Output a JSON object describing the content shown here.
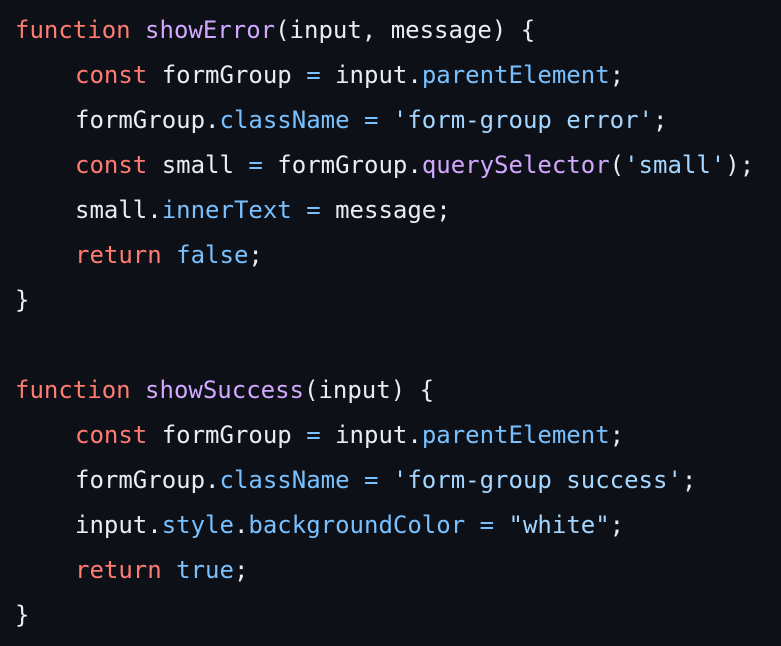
{
  "colors": {
    "background": "#0d1117",
    "text": "#e6edf3",
    "keyword": "#ff7b72",
    "function_name": "#d2a8ff",
    "property": "#79c0ff",
    "string": "#a5d6ff"
  },
  "code": {
    "lines": [
      {
        "indent": 0,
        "tokens": [
          {
            "text": "function",
            "type": "kw"
          },
          {
            "text": " ",
            "type": "plain"
          },
          {
            "text": "showError",
            "type": "fn"
          },
          {
            "text": "(input, message) {",
            "type": "plain"
          }
        ]
      },
      {
        "indent": 1,
        "tokens": [
          {
            "text": "const",
            "type": "kw"
          },
          {
            "text": " formGroup ",
            "type": "plain"
          },
          {
            "text": "=",
            "type": "prop"
          },
          {
            "text": " input.",
            "type": "plain"
          },
          {
            "text": "parentElement",
            "type": "prop"
          },
          {
            "text": ";",
            "type": "plain"
          }
        ]
      },
      {
        "indent": 1,
        "tokens": [
          {
            "text": "formGroup.",
            "type": "plain"
          },
          {
            "text": "className",
            "type": "prop"
          },
          {
            "text": " ",
            "type": "plain"
          },
          {
            "text": "=",
            "type": "prop"
          },
          {
            "text": " ",
            "type": "plain"
          },
          {
            "text": "'form-group error'",
            "type": "str"
          },
          {
            "text": ";",
            "type": "plain"
          }
        ]
      },
      {
        "indent": 1,
        "tokens": [
          {
            "text": "const",
            "type": "kw"
          },
          {
            "text": " small ",
            "type": "plain"
          },
          {
            "text": "=",
            "type": "prop"
          },
          {
            "text": " formGroup.",
            "type": "plain"
          },
          {
            "text": "querySelector",
            "type": "fn"
          },
          {
            "text": "(",
            "type": "plain"
          },
          {
            "text": "'small'",
            "type": "str"
          },
          {
            "text": ");",
            "type": "plain"
          }
        ]
      },
      {
        "indent": 1,
        "tokens": [
          {
            "text": "small.",
            "type": "plain"
          },
          {
            "text": "innerText",
            "type": "prop"
          },
          {
            "text": " ",
            "type": "plain"
          },
          {
            "text": "=",
            "type": "prop"
          },
          {
            "text": " message;",
            "type": "plain"
          }
        ]
      },
      {
        "indent": 1,
        "tokens": [
          {
            "text": "return",
            "type": "kw"
          },
          {
            "text": " ",
            "type": "plain"
          },
          {
            "text": "false",
            "type": "prop"
          },
          {
            "text": ";",
            "type": "plain"
          }
        ]
      },
      {
        "indent": 0,
        "tokens": [
          {
            "text": "}",
            "type": "plain"
          }
        ]
      },
      {
        "indent": 0,
        "tokens": []
      },
      {
        "indent": 0,
        "tokens": [
          {
            "text": "function",
            "type": "kw"
          },
          {
            "text": " ",
            "type": "plain"
          },
          {
            "text": "showSuccess",
            "type": "fn"
          },
          {
            "text": "(input) {",
            "type": "plain"
          }
        ]
      },
      {
        "indent": 1,
        "tokens": [
          {
            "text": "const",
            "type": "kw"
          },
          {
            "text": " formGroup ",
            "type": "plain"
          },
          {
            "text": "=",
            "type": "prop"
          },
          {
            "text": " input.",
            "type": "plain"
          },
          {
            "text": "parentElement",
            "type": "prop"
          },
          {
            "text": ";",
            "type": "plain"
          }
        ]
      },
      {
        "indent": 1,
        "tokens": [
          {
            "text": "formGroup.",
            "type": "plain"
          },
          {
            "text": "className",
            "type": "prop"
          },
          {
            "text": " ",
            "type": "plain"
          },
          {
            "text": "=",
            "type": "prop"
          },
          {
            "text": " ",
            "type": "plain"
          },
          {
            "text": "'form-group success'",
            "type": "str"
          },
          {
            "text": ";",
            "type": "plain"
          }
        ]
      },
      {
        "indent": 1,
        "tokens": [
          {
            "text": "input.",
            "type": "plain"
          },
          {
            "text": "style",
            "type": "prop"
          },
          {
            "text": ".",
            "type": "plain"
          },
          {
            "text": "backgroundColor",
            "type": "prop"
          },
          {
            "text": " ",
            "type": "plain"
          },
          {
            "text": "=",
            "type": "prop"
          },
          {
            "text": " ",
            "type": "plain"
          },
          {
            "text": "\"white\"",
            "type": "str"
          },
          {
            "text": ";",
            "type": "plain"
          }
        ]
      },
      {
        "indent": 1,
        "tokens": [
          {
            "text": "return",
            "type": "kw"
          },
          {
            "text": " ",
            "type": "plain"
          },
          {
            "text": "true",
            "type": "prop"
          },
          {
            "text": ";",
            "type": "plain"
          }
        ]
      },
      {
        "indent": 0,
        "tokens": [
          {
            "text": "}",
            "type": "plain"
          }
        ]
      }
    ]
  }
}
